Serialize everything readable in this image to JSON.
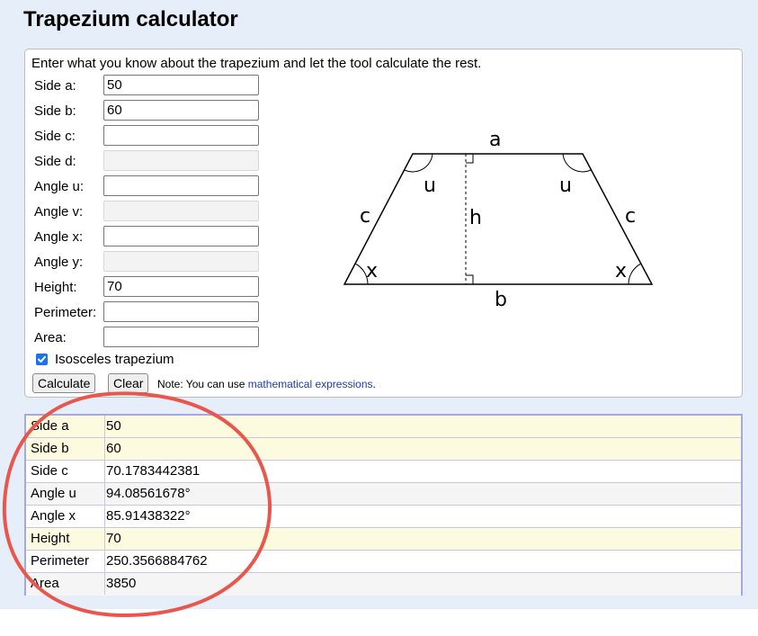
{
  "page": {
    "title": "Trapezium calculator",
    "intro": "Enter what you know about the trapezium and let the tool calculate the rest."
  },
  "form": {
    "fields": [
      {
        "label": "Side a:",
        "value": "50",
        "disabled": false
      },
      {
        "label": "Side b:",
        "value": "60",
        "disabled": false
      },
      {
        "label": "Side c:",
        "value": "",
        "disabled": false
      },
      {
        "label": "Side d:",
        "value": "",
        "disabled": true
      },
      {
        "label": "Angle u:",
        "value": "",
        "disabled": false
      },
      {
        "label": "Angle v:",
        "value": "",
        "disabled": true
      },
      {
        "label": "Angle x:",
        "value": "",
        "disabled": false
      },
      {
        "label": "Angle y:",
        "value": "",
        "disabled": true
      },
      {
        "label": "Height:",
        "value": "70",
        "disabled": false
      },
      {
        "label": "Perimeter:",
        "value": "",
        "disabled": false
      },
      {
        "label": "Area:",
        "value": "",
        "disabled": false
      }
    ],
    "isosceles": {
      "label": "Isosceles trapezium",
      "checked": true
    },
    "calculate_label": "Calculate",
    "clear_label": "Clear",
    "note_prefix": "Note: You can use",
    "note_link": "mathematical expressions",
    "note_suffix": "."
  },
  "diagram": {
    "labels": {
      "a": "a",
      "b": "b",
      "c_left": "c",
      "c_right": "c",
      "h": "h",
      "u_left": "u",
      "u_right": "u",
      "x_left": "x",
      "x_right": "x"
    }
  },
  "results": [
    {
      "key": "Side a",
      "value": "50",
      "highlight": true
    },
    {
      "key": "Side b",
      "value": "60",
      "highlight": true
    },
    {
      "key": "Side c",
      "value": "70.1783442381",
      "highlight": false
    },
    {
      "key": "Angle u",
      "value": "94.08561678°",
      "highlight": false
    },
    {
      "key": "Angle x",
      "value": "85.91438322°",
      "highlight": false
    },
    {
      "key": "Height",
      "value": "70",
      "highlight": true
    },
    {
      "key": "Perimeter",
      "value": "250.3566884762",
      "highlight": false
    },
    {
      "key": "Area",
      "value": "3850",
      "highlight": false
    }
  ],
  "colors": {
    "page_background": "#e6eef9",
    "highlight_row": "#fdfbdf",
    "results_border": "#a8a8e0",
    "annotation_circle": "#e8574e",
    "link": "#1a3ea8"
  }
}
